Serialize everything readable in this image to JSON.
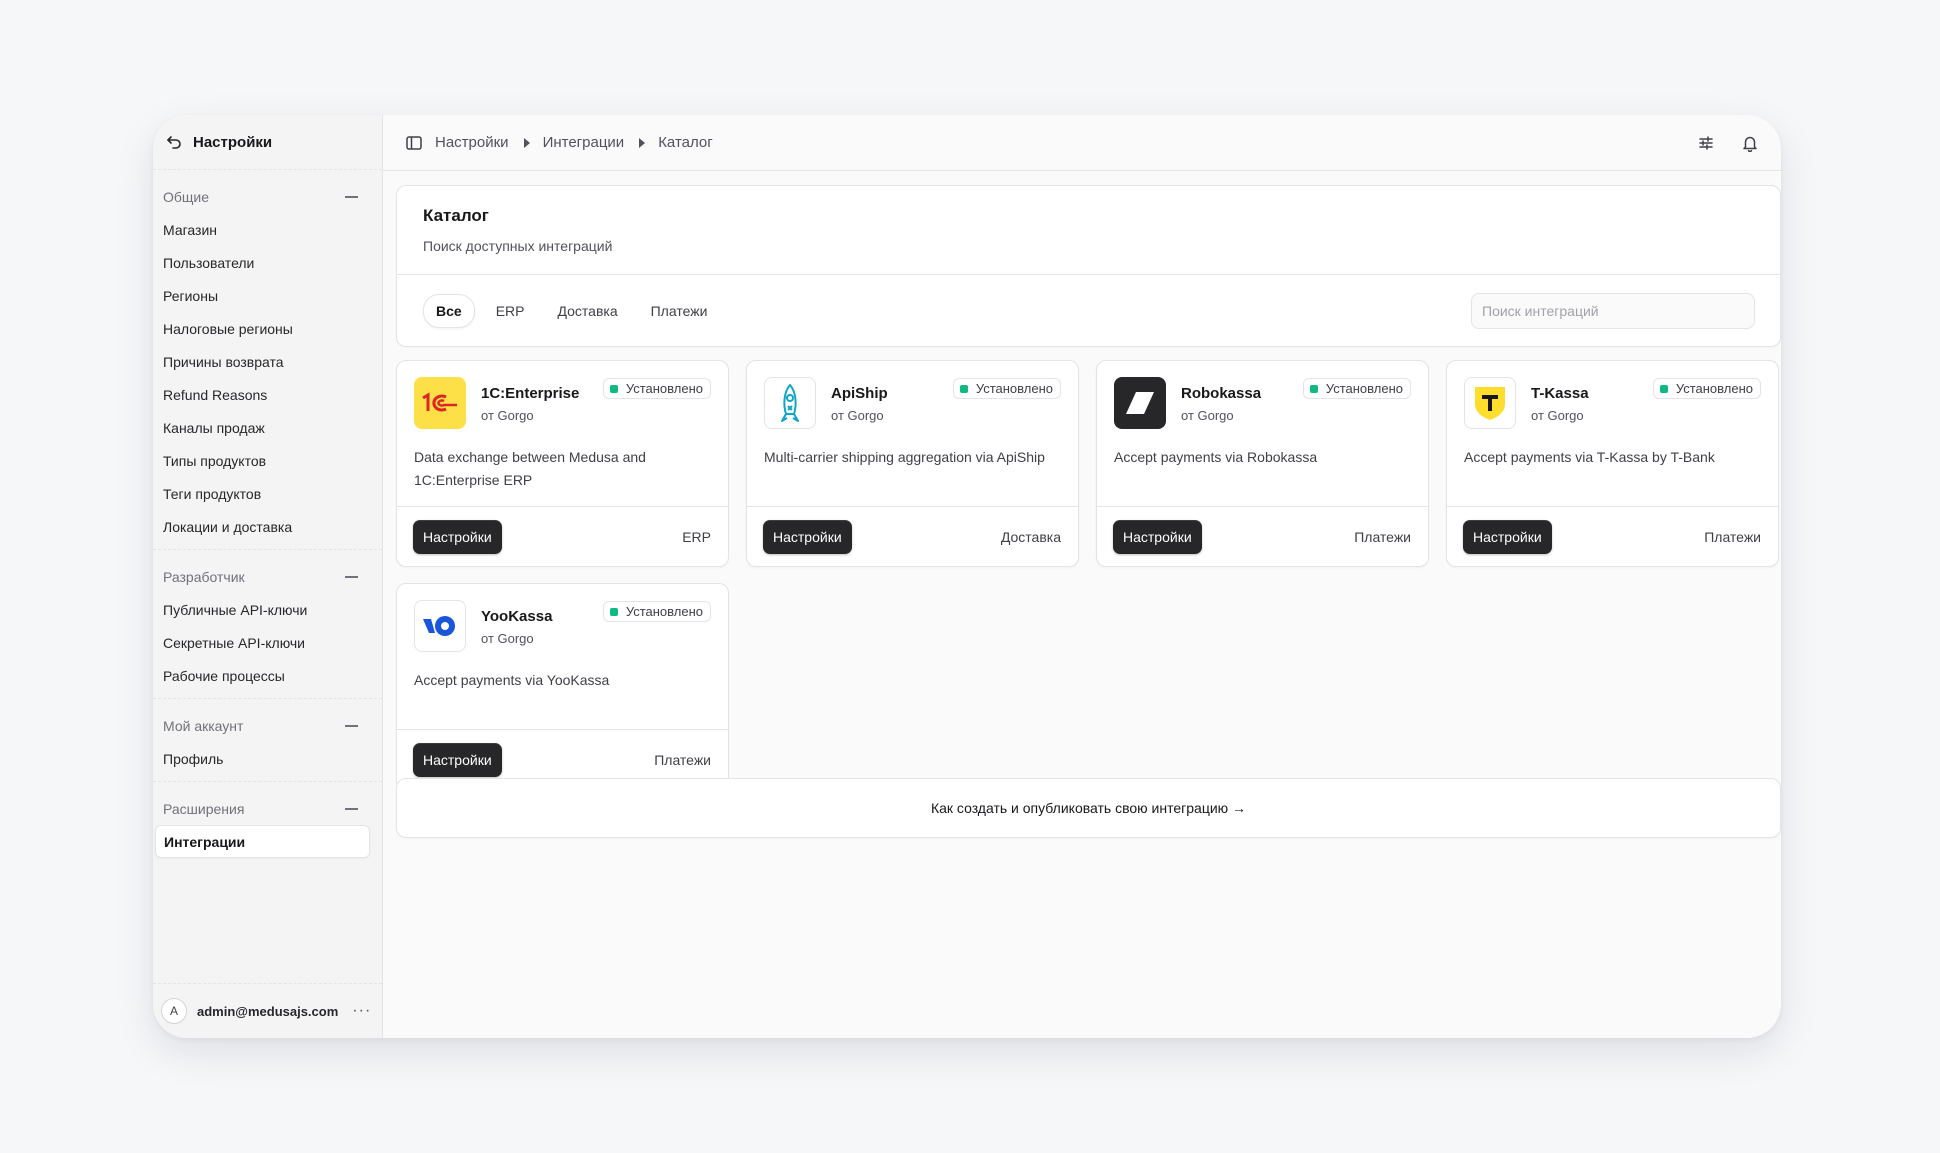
{
  "sidebar": {
    "title": "Настройки",
    "sections": [
      {
        "label": "Общие",
        "items": [
          "Магазин",
          "Пользователи",
          "Регионы",
          "Налоговые регионы",
          "Причины возврата",
          "Refund Reasons",
          "Каналы продаж",
          "Типы продуктов",
          "Теги продуктов",
          "Локации и доставка"
        ]
      },
      {
        "label": "Разработчик",
        "items": [
          "Публичные API-ключи",
          "Секретные API-ключи",
          "Рабочие процессы"
        ]
      },
      {
        "label": "Мой аккаунт",
        "items": [
          "Профиль"
        ]
      },
      {
        "label": "Расширения",
        "items": [
          "Интеграции"
        ]
      }
    ],
    "active_item": "Интеграции",
    "user": {
      "initial": "A",
      "email": "admin@medusajs.com",
      "more": "···"
    }
  },
  "breadcrumb": [
    "Настройки",
    "Интеграции",
    "Каталог"
  ],
  "catalog": {
    "title": "Каталог",
    "subtitle": "Поиск доступных интеграций",
    "filters": [
      "Все",
      "ERP",
      "Доставка",
      "Платежи"
    ],
    "active_filter": "Все",
    "search_placeholder": "Поиск интеграций"
  },
  "integrations": [
    {
      "name": "1C:Enterprise",
      "by": "от Gorgo",
      "status": "Установлено",
      "description": "Data exchange between Medusa and 1C:Enterprise ERP",
      "button": "Настройки",
      "category": "ERP",
      "logo": "1c-logo"
    },
    {
      "name": "ApiShip",
      "by": "от Gorgo",
      "status": "Установлено",
      "description": "Multi-carrier shipping aggregation via ApiShip",
      "button": "Настройки",
      "category": "Доставка",
      "logo": "apiship-logo"
    },
    {
      "name": "Robokassa",
      "by": "от Gorgo",
      "status": "Установлено",
      "description": "Accept payments via Robokassa",
      "button": "Настройки",
      "category": "Платежи",
      "logo": "robokassa-logo"
    },
    {
      "name": "T-Kassa",
      "by": "от Gorgo",
      "status": "Установлено",
      "description": "Accept payments via T-Kassa by T-Bank",
      "button": "Настройки",
      "category": "Платежи",
      "logo": "tkassa-logo"
    },
    {
      "name": "YooKassa",
      "by": "от Gorgo",
      "status": "Установлено",
      "description": "Accept payments via YooKassa",
      "button": "Настройки",
      "category": "Платежи",
      "logo": "yookassa-logo"
    }
  ],
  "guide_link": "Как создать и опубликовать свою интеграцию →",
  "colors": {
    "status_dot": "#10b981",
    "button_bg": "#27272a",
    "onec_yellow": "#fde047",
    "onec_red": "#dc2626",
    "yoo_blue": "#1a56db",
    "tkassa_yellow": "#ffdd2d"
  }
}
